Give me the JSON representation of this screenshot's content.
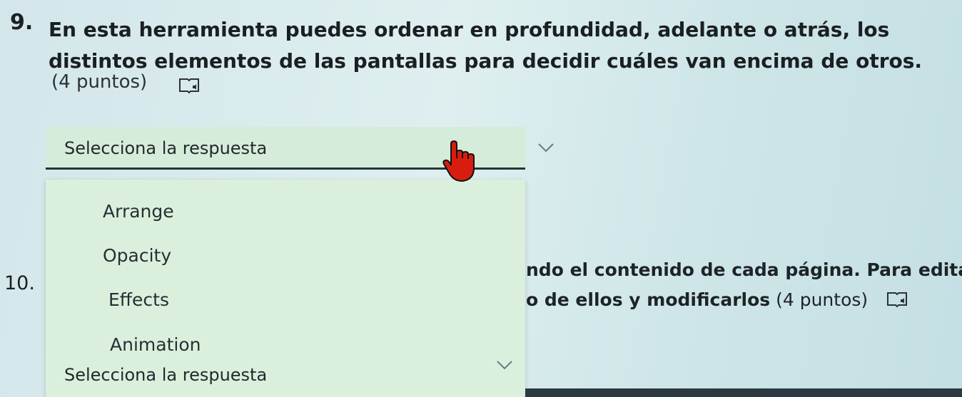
{
  "question9": {
    "number": "9.",
    "text": "En esta herramienta puedes ordenar en profundidad, adelante o atrás, los distintos elementos de las pantallas para decidir cuáles van encima de otros.",
    "points": "(4 puntos)"
  },
  "select1": {
    "selected": "Selecciona la respuesta",
    "options": [
      "Arrange",
      "Opacity",
      "Effects",
      "Animation"
    ]
  },
  "question10": {
    "number": "10.",
    "line1_visible": "ndo el contenido de cada página. Para editar",
    "line2_visible": "o de ellos y modificarlos",
    "points": "(4 puntos)"
  },
  "select2": {
    "selected": "Selecciona la respuesta"
  },
  "icons": {
    "reader": "immersive-reader-icon",
    "chevron": "chevron-down-icon",
    "cursor": "hand-pointer-icon"
  },
  "colors": {
    "background": "#d3e6ea",
    "select_bg": "#d6ecda",
    "dropdown_bg": "#dbefdd",
    "cursor_red": "#d81c10"
  }
}
